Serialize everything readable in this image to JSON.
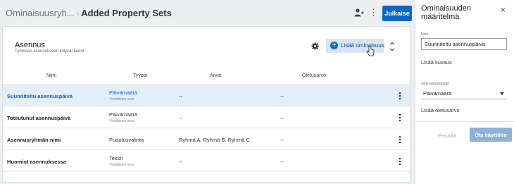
{
  "header": {
    "breadcrumb_root": "Ominaisuusryh...",
    "breadcrumb_sep": "›",
    "title": "Added Property Sets",
    "more_glyph": "⋮",
    "publish_label": "Julkaise"
  },
  "section": {
    "title": "Asennus",
    "subtitle": "Työmaan asennukseen liittyvät tiedot",
    "add_label": "Lisää ominaisuus"
  },
  "table": {
    "columns": [
      "Nimi",
      "Tyyppi",
      "Arvot",
      "Oletusarvo"
    ],
    "rows": [
      {
        "name": "Suunniteltu asennuspäivä",
        "type": "Päivämäärä",
        "type_sub": "Yksittäinen arvo",
        "values": "--",
        "default": "--"
      },
      {
        "name": "Toteutunut asennuspäivä",
        "type": "Päivämäärä",
        "type_sub": "Yksittäinen arvo",
        "values": "--",
        "default": "--"
      },
      {
        "name": "Asennusryhmän nimi",
        "type": "Pudotusvalinta",
        "type_sub": "",
        "values": "Ryhmä A, Ryhmä B, Ryhmä C",
        "default": "--"
      },
      {
        "name": "Huomiot asennuksessa",
        "type": "Teksti",
        "type_sub": "Yksittäinen arvo",
        "values": "--",
        "default": "--"
      }
    ]
  },
  "panel": {
    "title": "Ominaisuuden määritelmä",
    "close_glyph": "×",
    "name_label": "Nimi",
    "name_value": "Suunniteltu asennuspäivä",
    "add_description": "Lisää kuvaus",
    "type_label": "Ominaisuustyyppi",
    "type_value": "Päivämäärä",
    "add_default": "Lisää oletusarvo",
    "cancel_label": "Peruuta",
    "apply_label": "Ota käyttöön"
  },
  "colors": {
    "accent": "#0b66c2",
    "selected_row": "#e4eef9",
    "disabled_button": "#8fb1d6"
  }
}
